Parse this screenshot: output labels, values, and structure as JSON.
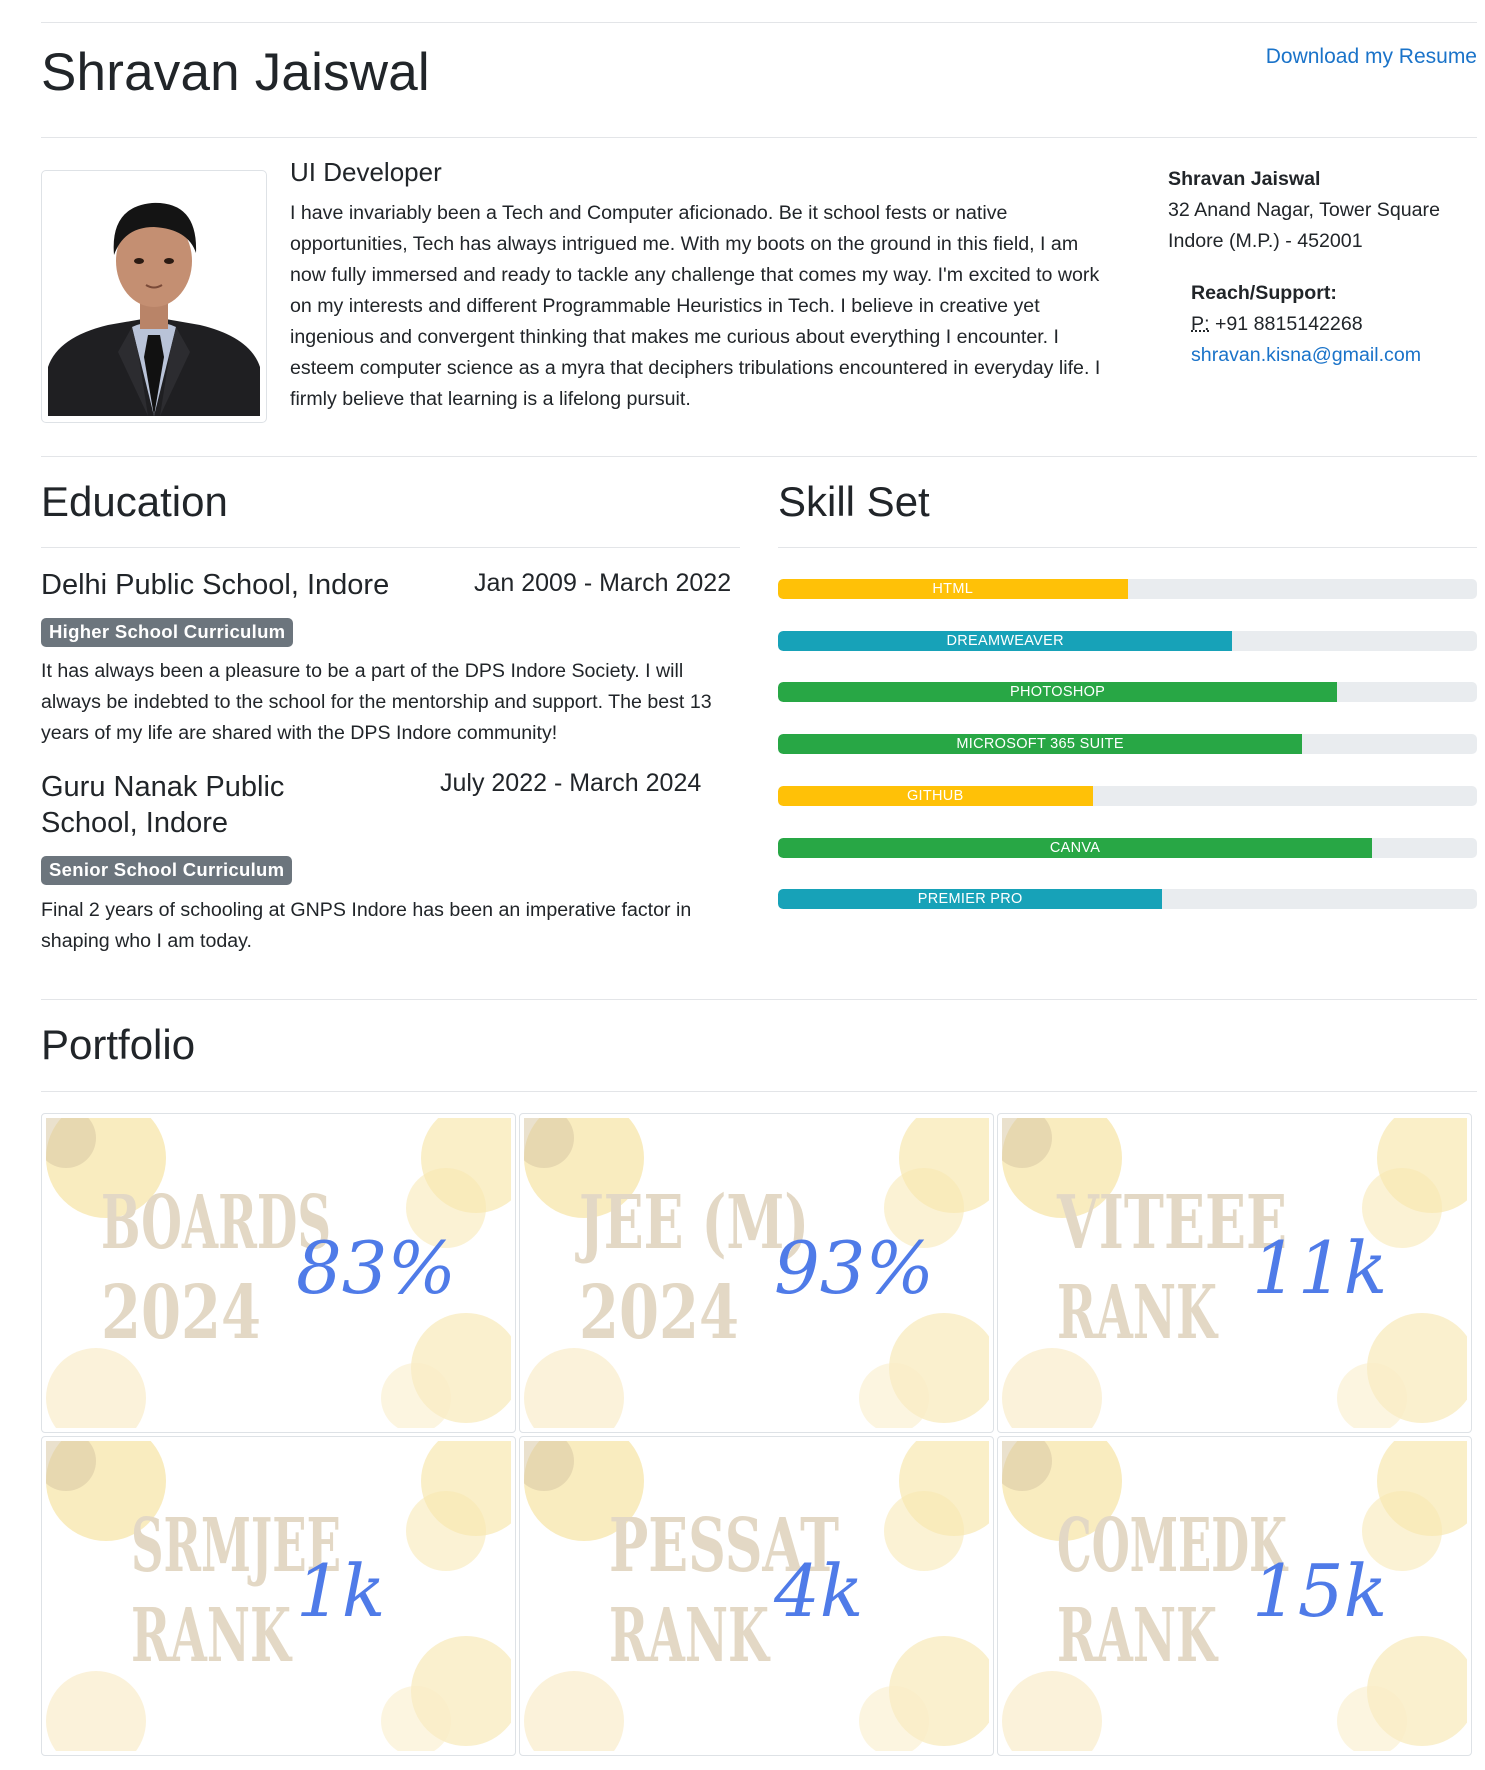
{
  "header": {
    "name": "Shravan Jaiswal",
    "download_link": "Download my Resume"
  },
  "profile": {
    "role": "UI Developer",
    "bio": "I have invariably been a Tech and Computer aficionado. Be it school fests or native opportunities, Tech has always intrigued me. With my boots on the ground in this field, I am now fully immersed and ready to tackle any challenge that comes my way. I'm excited to work on my interests and different Programmable Heuristics in Tech. I believe in creative yet ingenious and convergent thinking that makes me curious about everything I encounter. I esteem computer science as a myra that deciphers tribulations encountered in everyday life. I firmly believe that learning is a lifelong pursuit."
  },
  "contact": {
    "name": "Shravan Jaiswal",
    "address_line1": "32 Anand Nagar, Tower Square",
    "address_line2": "Indore (M.P.) - 452001",
    "reach_heading": "Reach/Support:",
    "phone_label": "P:",
    "phone": "+91 8815142268",
    "email": "shravan.kisna@gmail.com"
  },
  "education": {
    "heading": "Education",
    "items": [
      {
        "school": "Delhi Public School, Indore",
        "dates": "Jan 2009 - March 2022",
        "badge": "Higher School Curriculum",
        "description": "It has always been a pleasure to be a part of the DPS Indore Society. I will always be indebted to the school for the mentorship and support. The best 13 years of my life are shared with the DPS Indore community!"
      },
      {
        "school_line1": "Guru Nanak Public",
        "school_line2": "School, Indore",
        "dates": "July 2022 - March 2024",
        "badge": "Senior School Curriculum",
        "description": "Final 2 years of schooling at GNPS Indore has been an imperative factor in shaping who I am today."
      }
    ]
  },
  "skills": {
    "heading": "Skill Set",
    "items": [
      {
        "label": "HTML",
        "level": 0.5,
        "color": "#ffc107"
      },
      {
        "label": "DREAMWEAVER",
        "level": 0.65,
        "color": "#17a2b8"
      },
      {
        "label": "PHOTOSHOP",
        "level": 0.8,
        "color": "#28a745"
      },
      {
        "label": "MICROSOFT 365 SUITE",
        "level": 0.75,
        "color": "#28a745"
      },
      {
        "label": "GITHUB",
        "level": 0.45,
        "color": "#ffc107"
      },
      {
        "label": "CANVA",
        "level": 0.85,
        "color": "#28a745"
      },
      {
        "label": "PREMIER PRO",
        "level": 0.55,
        "color": "#17a2b8"
      }
    ]
  },
  "portfolio": {
    "heading": "Portfolio",
    "tiles": [
      {
        "line1": "BOARDS",
        "line2": "2024",
        "value": "83%"
      },
      {
        "line1": "JEE (M)",
        "line2": "2024",
        "value": "93%"
      },
      {
        "line1": "VITEEE",
        "line2": "RANK",
        "value": "11k"
      },
      {
        "line1": "SRMJEE",
        "line2": "RANK",
        "value": "1k"
      },
      {
        "line1": "PESSAT",
        "line2": "RANK",
        "value": "4k"
      },
      {
        "line1": "COMEDK",
        "line2": "RANK",
        "value": "15k"
      }
    ]
  }
}
